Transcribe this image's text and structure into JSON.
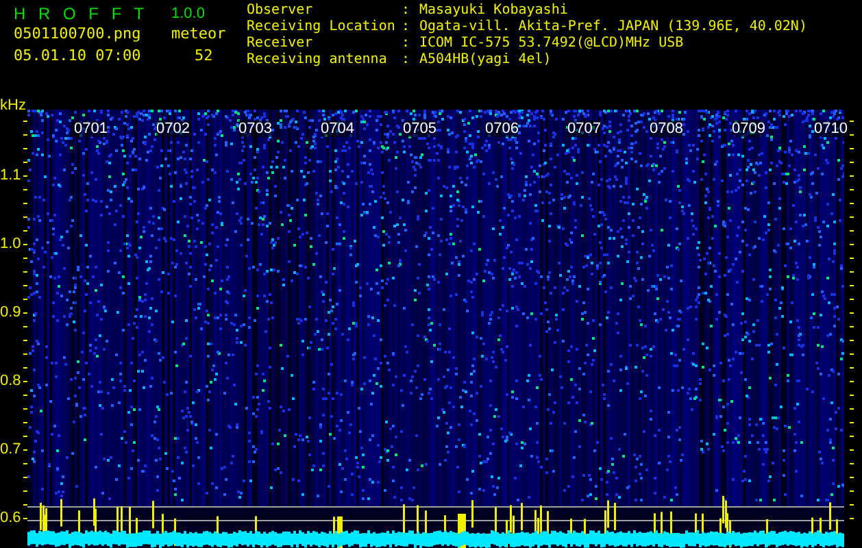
{
  "app": {
    "name": "H R O F F T",
    "version": "1.0.0"
  },
  "file": {
    "name": "0501100700.png",
    "datetime": "05.01.10 07:00"
  },
  "meteor": {
    "label": "meteor",
    "count": "52"
  },
  "info": {
    "separator": ":",
    "rows": [
      {
        "label": "Observer",
        "value": "Masayuki Kobayashi"
      },
      {
        "label": "Receiving Location",
        "value": "Ogata-vill. Akita-Pref. JAPAN (139.96E, 40.02N)"
      },
      {
        "label": "Receiver",
        "value": "ICOM IC-575 53.7492(@LCD)MHz USB"
      },
      {
        "label": "Receiving antenna",
        "value": "A504HB(yagi 4el)"
      }
    ]
  },
  "spectrogram": {
    "y_unit": "kHz",
    "y_labels": [
      "1.1",
      "1.0",
      "0.9",
      "0.8",
      "0.7",
      "0.6"
    ],
    "time_labels": [
      "0701",
      "0702",
      "0703",
      "0704",
      "0705",
      "0706",
      "0707",
      "0708",
      "0709",
      "0710"
    ]
  }
}
